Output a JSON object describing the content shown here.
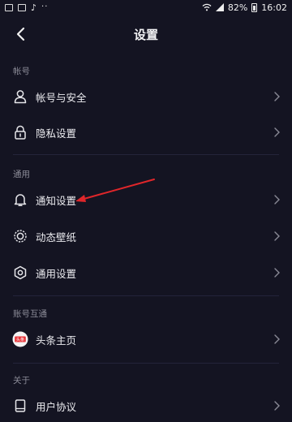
{
  "status_bar": {
    "tiktok_glyph": "♪",
    "dots": "··",
    "battery": "82%",
    "time": "16:02"
  },
  "header": {
    "title": "设置"
  },
  "sections": [
    {
      "label": "帐号",
      "items": [
        {
          "label": "帐号与安全",
          "icon": "user-icon"
        },
        {
          "label": "隐私设置",
          "icon": "lock-icon"
        }
      ]
    },
    {
      "label": "通用",
      "items": [
        {
          "label": "通知设置",
          "icon": "bell-icon"
        },
        {
          "label": "动态壁纸",
          "icon": "wallpaper-icon"
        },
        {
          "label": "通用设置",
          "icon": "gear-icon"
        }
      ]
    },
    {
      "label": "账号互通",
      "items": [
        {
          "label": "头条主页",
          "icon": "toutiao-icon",
          "icon_text": "头条"
        }
      ]
    },
    {
      "label": "关于",
      "items": [
        {
          "label": "用户协议",
          "icon": "book-icon"
        }
      ]
    }
  ],
  "colors": {
    "background": "#141422",
    "annotation_arrow": "#e0262a",
    "toutiao_red": "#e8353a"
  }
}
